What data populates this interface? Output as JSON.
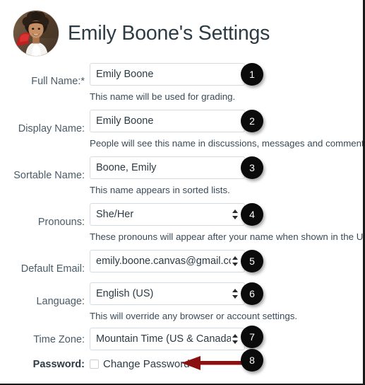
{
  "page": {
    "title": "Emily Boone's Settings",
    "avatar_alt": "user-avatar-photo",
    "accent_badge_color": "#0b0b0b",
    "arrow_color": "#8B1111",
    "label_color": "#4a5b68",
    "title_color": "#2D3B45"
  },
  "fields": [
    {
      "label": "Full Name:*",
      "type": "text",
      "value": "Emily Boone",
      "hint": "This name will be used for grading.",
      "badge": "1"
    },
    {
      "label": "Display Name:",
      "type": "text",
      "value": "Emily Boone",
      "hint": "People will see this name in discussions, messages and comments.",
      "badge": "2"
    },
    {
      "label": "Sortable Name:",
      "type": "text",
      "value": "Boone, Emily",
      "hint": "This name appears in sorted lists.",
      "badge": "3"
    },
    {
      "label": "Pronouns:",
      "type": "select",
      "value": "She/Her",
      "hint": "These pronouns will appear after your name when shown in the UI",
      "badge": "4"
    },
    {
      "label": "Default Email:",
      "type": "select",
      "value": "emily.boone.canvas@gmail.com",
      "hint": "",
      "badge": "5"
    },
    {
      "label": "Language:",
      "type": "select",
      "value": "English (US)",
      "hint": "This will override any browser or account settings.",
      "badge": "6"
    },
    {
      "label": "Time Zone:",
      "type": "select",
      "value": "Mountain Time (US & Canada) (-",
      "hint": "",
      "badge": "7"
    }
  ],
  "password": {
    "label": "Password:",
    "checkbox_label": "Change Password",
    "checked": false,
    "badge": "8"
  }
}
